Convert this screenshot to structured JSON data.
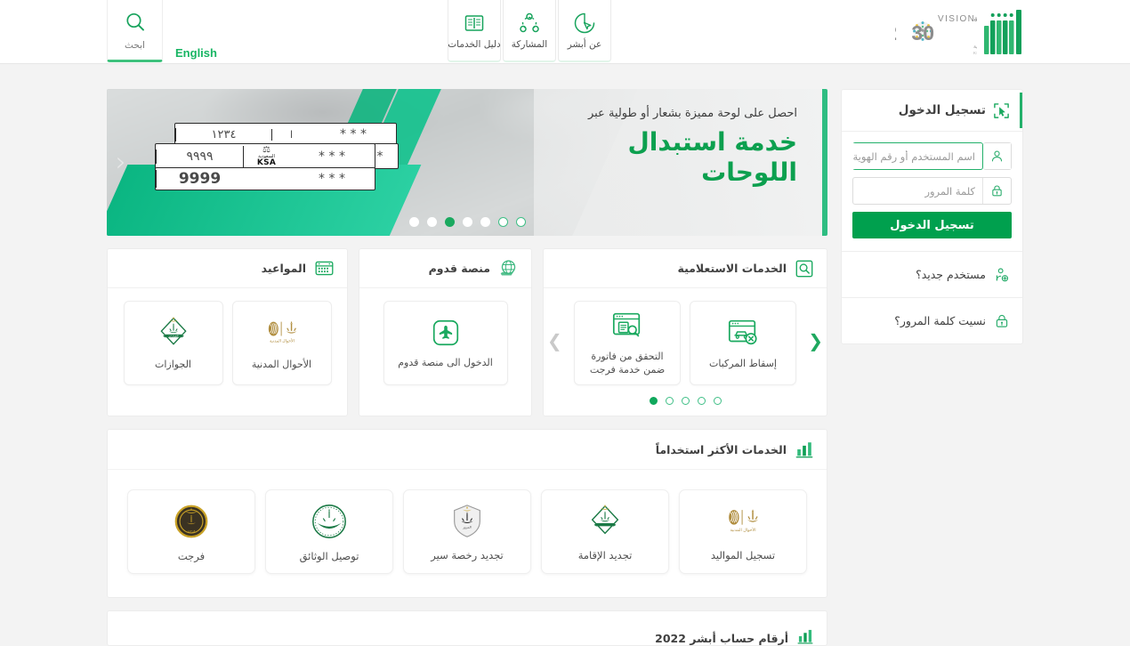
{
  "header": {
    "search": {
      "label": "ابحث",
      "icon": "search-icon"
    },
    "english_link": "English",
    "nav": [
      {
        "label": "عن أبشر",
        "icon": "cursor-circle-icon"
      },
      {
        "label": "المشاركة",
        "icon": "share-nodes-icon"
      },
      {
        "label": "دليل الخدمات",
        "icon": "book-icon"
      }
    ],
    "vision_logo": {
      "vision_word": "VISION",
      "vision_ar": "رؤيـــة",
      "year": "2030",
      "kingdom_ar": "المملكة العربية السعودية",
      "kingdom_en": "KINGDOM OF SAUDI ARABIA"
    },
    "absher_logo_alt": "أبشر"
  },
  "login": {
    "title": "تسجيل الدخول",
    "title_icon": "cursor-select-icon",
    "username_placeholder": "اسم المستخدم أو رقم الهوية",
    "username_value": "",
    "username_icon": "user-icon",
    "password_placeholder": "كلمة المرور",
    "password_value": "",
    "password_icon": "lock-icon",
    "submit_label": "تسجيل الدخول",
    "new_user_label": "مستخدم جديد؟",
    "new_user_icon": "user-plus-icon",
    "forgot_password_label": "نسيت كلمة المرور؟",
    "forgot_password_icon": "lock-question-icon"
  },
  "banner": {
    "subtitle": "احصل على لوحة مميزة بشعار أو طولية عبر",
    "title": "خدمة استبدال اللوحات",
    "plate": {
      "top_digits_ar": "١٢٣٤",
      "top_letter": "ا",
      "top_letters": "* * *",
      "mid_digits_ar": "٩٩٩٩",
      "mid_letters": "* * *",
      "bot_digits_en": "9999",
      "bot_letters": "* * *",
      "extra_letter": "*",
      "ksa_ar": "السعودية",
      "ksa_en": "KSA"
    },
    "prev_icon": "chevron-right-icon",
    "next_icon": "chevron-left-icon",
    "dots_total": 7,
    "dots_active_index": 4
  },
  "cards": [
    {
      "title": "الخدمات الاستعلامية",
      "icon": "magnifier-box-icon",
      "tiles": [
        {
          "caption": "إسقاط المركبات",
          "icon": "vehicle-cancel-icon"
        },
        {
          "caption": "التحقق من فاتورة ضمن خدمة فرجت",
          "icon": "document-search-icon"
        }
      ],
      "dots_total": 5,
      "dots_active_index": 4,
      "prev_icon": "chevron-right-icon",
      "next_icon": "chevron-left-icon"
    },
    {
      "title": "منصة قدوم",
      "icon": "globe-plane-icon",
      "tiles": [
        {
          "caption": "الدخول الى منصة قدوم",
          "icon": "plane-box-icon"
        }
      ]
    },
    {
      "title": "المواعيد",
      "icon": "calendar-icon",
      "tiles": [
        {
          "caption": "الأحوال المدنية",
          "icon": "civil-affairs-logo"
        },
        {
          "caption": "الجوازات",
          "icon": "passports-logo"
        }
      ]
    }
  ],
  "most_used": {
    "title": "الخدمات الأكثر استخداماً",
    "icon": "bar-chart-icon",
    "tiles": [
      {
        "caption": "تسجيل المواليد",
        "icon": "civil-affairs-logo"
      },
      {
        "caption": "تجديد الإقامة",
        "icon": "passports-logo"
      },
      {
        "caption": "تجديد رخصة سير",
        "icon": "traffic-logo"
      },
      {
        "caption": "توصيل الوثائق",
        "icon": "moi-logo"
      },
      {
        "caption": "فرجت",
        "icon": "farajat-logo"
      }
    ]
  },
  "bottom_section": {
    "title": "أرقام حساب أبشر 2022",
    "icon": "bar-chart-icon"
  },
  "colors": {
    "primary_green": "#00a04e",
    "accent_green": "#23b06a",
    "teal": "#19c28f",
    "gold": "#b08d3e",
    "page_bg": "#f3f3f3"
  }
}
